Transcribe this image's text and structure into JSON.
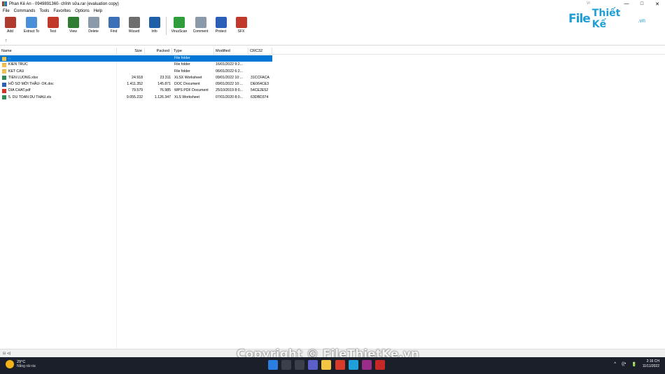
{
  "window": {
    "title": "Phan Kê An - 0949891360- chỉnh sửa.rar (evaluation copy)",
    "extra": "VI",
    "controls": [
      "—",
      "□",
      "✕"
    ]
  },
  "menu": [
    "File",
    "Commands",
    "Tools",
    "Favorites",
    "Options",
    "Help"
  ],
  "toolbar": [
    {
      "label": "Add",
      "icon": "add-archive-icon",
      "color": "#b03a2e"
    },
    {
      "label": "Extract To",
      "icon": "extract-folder-icon",
      "color": "#4a90d9"
    },
    {
      "label": "Test",
      "icon": "test-archive-icon",
      "color": "#c0392b"
    },
    {
      "label": "View",
      "icon": "view-book-icon",
      "color": "#2e7d32"
    },
    {
      "label": "Delete",
      "icon": "trash-icon",
      "color": "#8a9aa8"
    },
    {
      "label": "Find",
      "icon": "magnifier-icon",
      "color": "#3b6fb6"
    },
    {
      "label": "Wizard",
      "icon": "wand-icon",
      "color": "#6d6d6d"
    },
    {
      "label": "Info",
      "icon": "info-icon",
      "color": "#1e5fa8"
    },
    {
      "label": "VirusScan",
      "icon": "virus-scan-icon",
      "color": "#2e9d3a"
    },
    {
      "label": "Comment",
      "icon": "comment-icon",
      "color": "#8a9aa8"
    },
    {
      "label": "Protect",
      "icon": "shield-icon",
      "color": "#2b5fb8"
    },
    {
      "label": "SFX",
      "icon": "sfx-archive-icon",
      "color": "#c0392b"
    }
  ],
  "logo": {
    "text1": "File",
    "text2": "Thiết Kế",
    "text3": ".vn"
  },
  "path": {
    "up": "↑"
  },
  "columns": [
    "Name",
    "Size",
    "Packed",
    "Type",
    "Modified",
    "CRC32"
  ],
  "files": [
    {
      "name": "..",
      "size": "",
      "packed": "",
      "type": "File folder",
      "modified": "",
      "crc": "",
      "kind": "folder",
      "selected": true
    },
    {
      "name": "KIEN TRUC",
      "size": "",
      "packed": "",
      "type": "File folder",
      "modified": "16/01/2022 9:2...",
      "crc": "",
      "kind": "folder"
    },
    {
      "name": "KET CAU",
      "size": "",
      "packed": "",
      "type": "File folder",
      "modified": "06/01/2022 6:2...",
      "crc": "",
      "kind": "folder"
    },
    {
      "name": "TIEN LUONG.xlsx",
      "size": "24.918",
      "packed": "23.311",
      "type": "XLSX Worksheet",
      "modified": "09/01/2022 10:...",
      "crc": "31CCFACA",
      "kind": "xlsx"
    },
    {
      "name": "HỒ SƠ MỜI THẦU- OK.doc",
      "size": "1.411.352",
      "packed": "145.871",
      "type": "DOC Document",
      "modified": "09/01/2022 10:...",
      "crc": "DE064CE3",
      "kind": "docx"
    },
    {
      "name": "DIA CHAT.pdf",
      "size": "79.579",
      "packed": "76.985",
      "type": "WPS PDF Document",
      "modified": "25/10/2019 8:0...",
      "crc": "54CE2E52",
      "kind": "pdf"
    },
    {
      "name": "5. DU TOAN DU THAU.xls",
      "size": "9.055.232",
      "packed": "1.126.347",
      "type": "XLS Worksheet",
      "modified": "07/01/2020 8:0...",
      "crc": "63DBD374",
      "kind": "xlsx"
    }
  ],
  "status": {
    "left": "⊟ ⊲)"
  },
  "watermark": "Copyright © FileThietKe.vn",
  "taskbar": {
    "temp": "29°C",
    "weather": "Nắng rải rác",
    "time": "2:16 CH",
    "date": "11/11/2022",
    "tray": [
      "^",
      "((•",
      "🔋"
    ]
  }
}
